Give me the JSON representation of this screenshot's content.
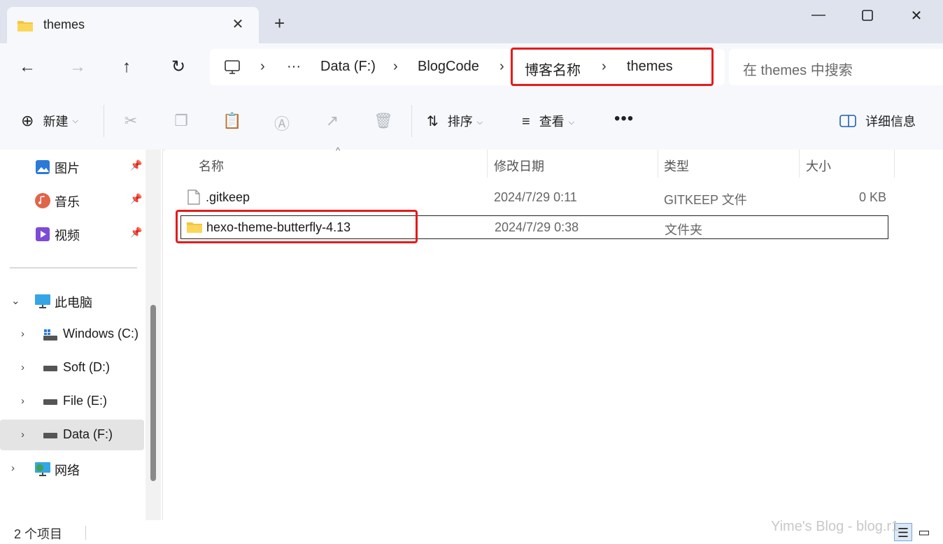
{
  "tab": {
    "title": "themes"
  },
  "address": {
    "crumbs": [
      "Data (F:)",
      "BlogCode",
      "博客名称",
      "themes"
    ],
    "ellipsis": "···"
  },
  "search": {
    "placeholder": "在 themes 中搜索"
  },
  "toolbar": {
    "new_label": "新建",
    "sort_label": "排序",
    "view_label": "查看",
    "details_label": "详细信息"
  },
  "sidebar": {
    "quick": [
      {
        "label": "图片",
        "icon": "pictures-icon"
      },
      {
        "label": "音乐",
        "icon": "music-icon"
      },
      {
        "label": "视频",
        "icon": "videos-icon"
      }
    ],
    "this_pc": "此电脑",
    "drives": [
      "Windows (C:)",
      "Soft (D:)",
      "File (E:)",
      "Data (F:)"
    ],
    "network": "网络"
  },
  "columns": {
    "name": "名称",
    "modified": "修改日期",
    "type": "类型",
    "size": "大小"
  },
  "files": [
    {
      "name": ".gitkeep",
      "modified": "2024/7/29 0:11",
      "type": "GITKEEP 文件",
      "size": "0 KB",
      "icon": "file-icon"
    },
    {
      "name": "hexo-theme-butterfly-4.13",
      "modified": "2024/7/29 0:38",
      "type": "文件夹",
      "size": "",
      "icon": "folder-icon"
    }
  ],
  "status": {
    "count": "2 个项目"
  },
  "watermark": "Yime's Blog - blog.r1"
}
